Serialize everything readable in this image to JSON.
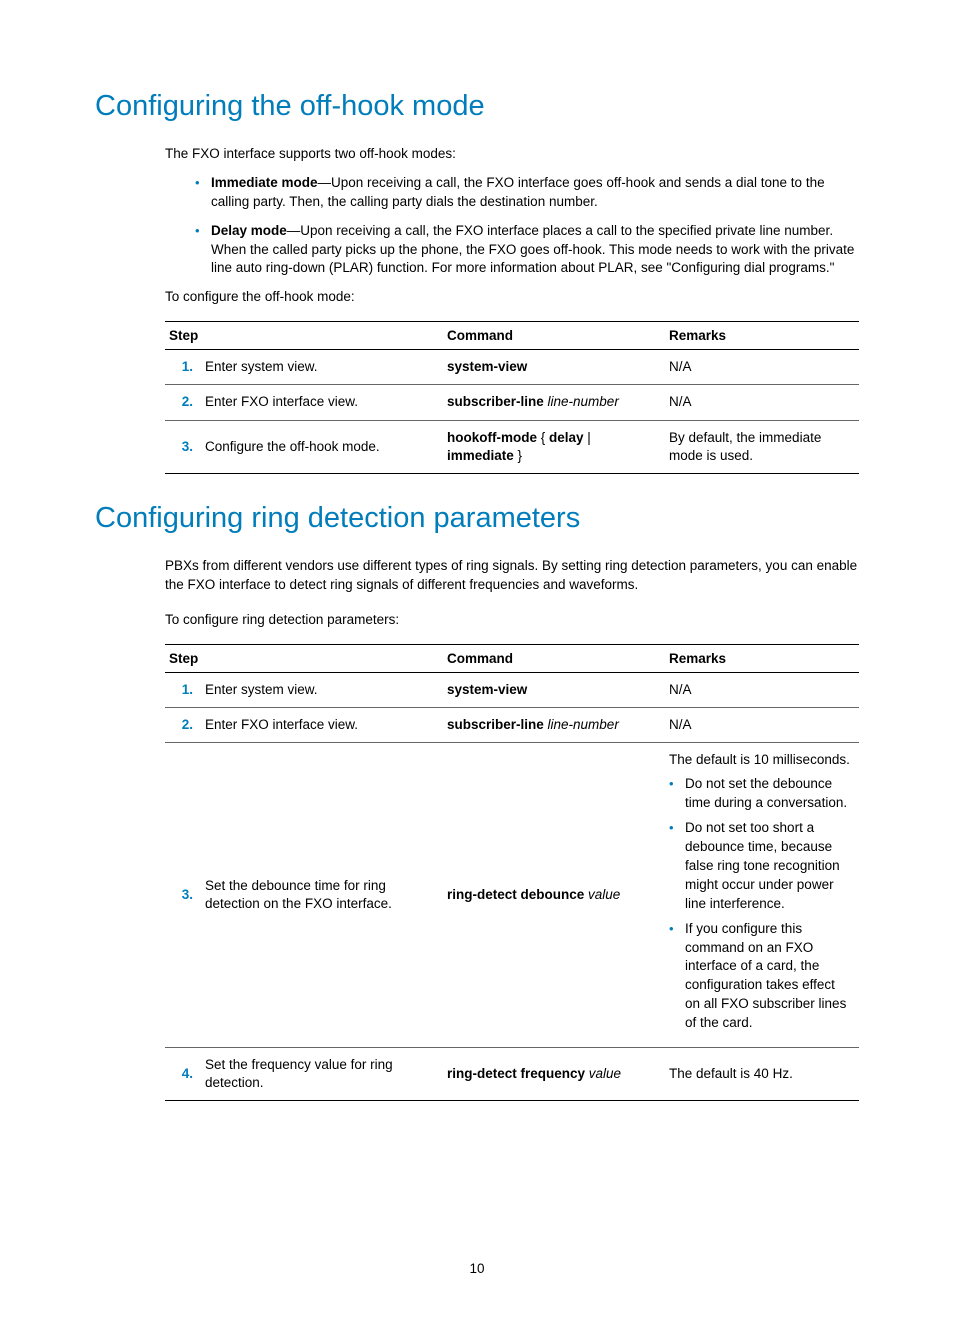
{
  "page_number": "10",
  "section1": {
    "title": "Configuring the off-hook mode",
    "intro": "The FXO interface supports two off-hook modes:",
    "bullet1_label": "Immediate mode",
    "bullet1_text": "—Upon receiving a call, the FXO interface goes off-hook and sends a dial tone to the calling party. Then, the calling party dials the destination number.",
    "bullet2_label": "Delay mode",
    "bullet2_text": "—Upon receiving a call, the FXO interface places a call to the specified private line number. When the called party picks up the phone, the FXO goes off-hook. This mode needs to work with the private line auto ring-down (PLAR) function. For more information about PLAR, see \"Configuring dial programs.\"",
    "lead": "To configure the off-hook mode:",
    "headers": {
      "step": "Step",
      "cmd": "Command",
      "remarks": "Remarks"
    },
    "rows": [
      {
        "num": "1.",
        "step": "Enter system view.",
        "cmd_bold": "system-view",
        "cmd_italic": "",
        "remarks": "N/A"
      },
      {
        "num": "2.",
        "step": "Enter FXO interface view.",
        "cmd_bold": "subscriber-line",
        "cmd_italic": " line-number",
        "remarks": "N/A"
      },
      {
        "num": "3.",
        "step": "Configure the off-hook mode.",
        "cmd_bold1": "hookoff-mode",
        "cmd_plain1": " { ",
        "cmd_bold2": "delay",
        "cmd_plain2": " | ",
        "cmd_bold3": "immediate",
        "cmd_plain3": " }",
        "remarks": "By default, the immediate mode is used."
      }
    ]
  },
  "section2": {
    "title": "Configuring ring detection parameters",
    "intro": "PBXs from different vendors use different types of ring signals. By setting ring detection parameters, you can enable the FXO interface to detect ring signals of different frequencies and waveforms.",
    "lead": "To configure ring detection parameters:",
    "headers": {
      "step": "Step",
      "cmd": "Command",
      "remarks": "Remarks"
    },
    "rows": [
      {
        "num": "1.",
        "step": "Enter system view.",
        "cmd_bold": "system-view",
        "cmd_italic": "",
        "remarks": "N/A"
      },
      {
        "num": "2.",
        "step": "Enter FXO interface view.",
        "cmd_bold": "subscriber-line",
        "cmd_italic": " line-number",
        "remarks": "N/A"
      },
      {
        "num": "3.",
        "step": "Set the debounce time for ring detection on the FXO interface.",
        "cmd_bold": "ring-detect debounce",
        "cmd_italic": " value",
        "remarks_intro": "The default is 10 milliseconds.",
        "remarks_b1": "Do not set the debounce time during a conversation.",
        "remarks_b2": "Do not set too short a debounce time, because false ring tone recognition might occur under power line interference.",
        "remarks_b3": "If you configure this command on an FXO interface of a card, the configuration takes effect on all FXO subscriber lines of the card."
      },
      {
        "num": "4.",
        "step": "Set the frequency value for ring detection.",
        "cmd_bold": "ring-detect frequency",
        "cmd_italic": " value",
        "remarks": "The default is 40 Hz."
      }
    ]
  }
}
